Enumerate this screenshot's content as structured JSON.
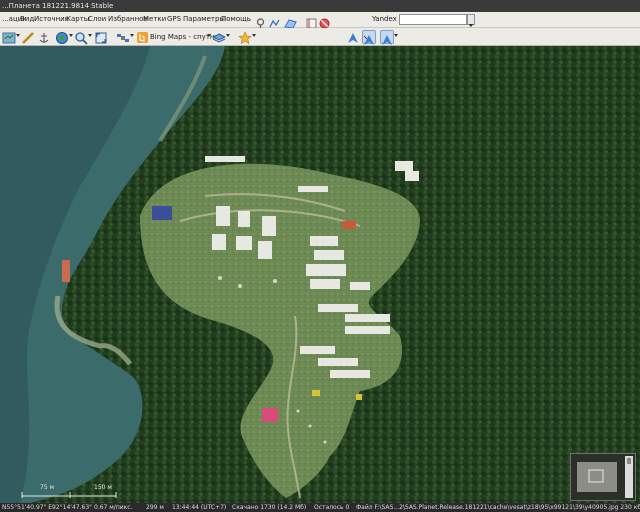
{
  "window": {
    "title": "...Планета 181221.9814 Stable"
  },
  "menu": {
    "items": [
      "...ации",
      "Вид",
      "Источник",
      "Карты",
      "Слои",
      "Избранное",
      "Метки",
      "GPS",
      "Параметры",
      "Помощь"
    ]
  },
  "search": {
    "provider": "Yandex",
    "value": ""
  },
  "toolbar": {
    "map_source_label": "Bing Maps - спутник"
  },
  "map": {
    "scale_left": "75 м",
    "scale_right": "150 м"
  },
  "status": {
    "coords": "N55°51'40.97\" E92°14'47.63\"",
    "resolution": "0.67 м/пикс.",
    "distance": "299 м",
    "time": "13:44:44 (UTC+7)",
    "downloaded": "Скачано 1730 (14.2 Мб)",
    "remaining": "Осталось 0",
    "file": "Файл F:\\SAS...2\\SAS.Planet.Release.181221\\cache\\vesat\\z18\\95\\x99121\\39\\y40905.jpg 230 кб"
  },
  "colors": {
    "water": "#3c6b6b",
    "forest": "#1f3a1c",
    "clearing": "#6f8a57",
    "toolbar_bg": "#ecebe6",
    "status_bg": "#2a2a2a"
  }
}
